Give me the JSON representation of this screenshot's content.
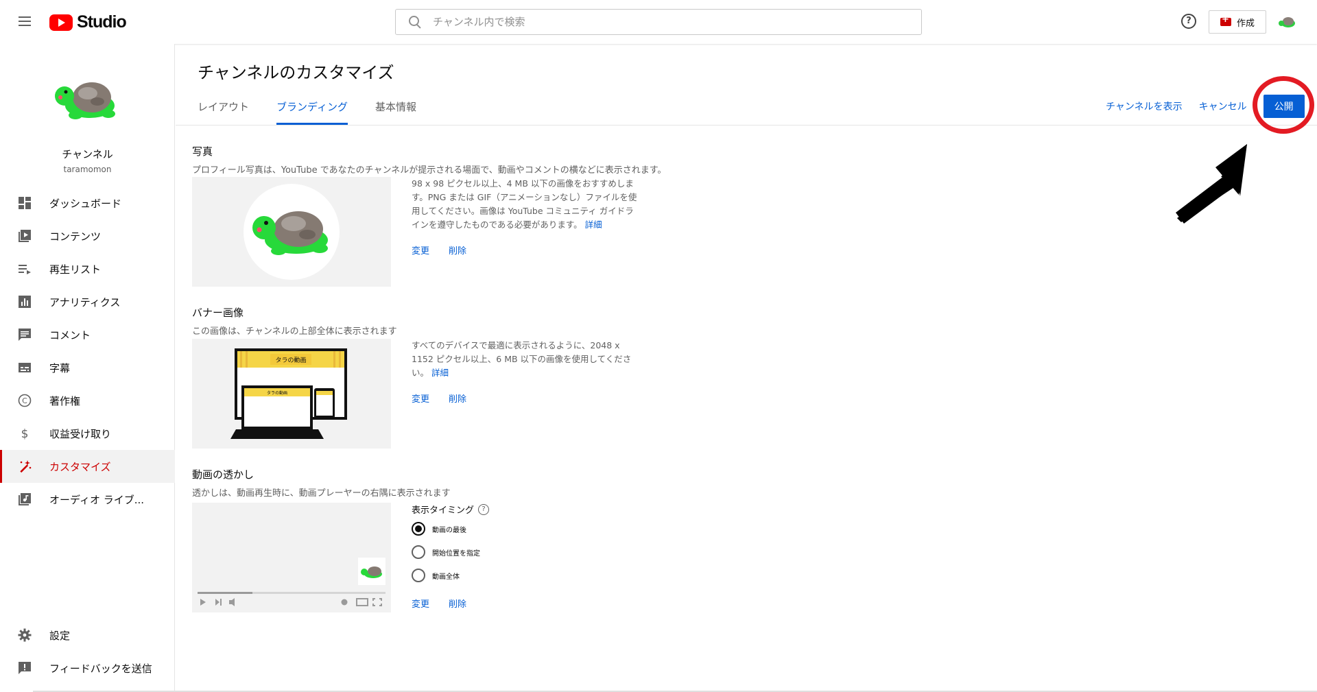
{
  "header": {
    "logo_text": "Studio",
    "search_placeholder": "チャンネル内で検索",
    "help_label": "?",
    "create_label": "作成"
  },
  "sidebar": {
    "channel_name": "チャンネル",
    "channel_handle": "taramomon",
    "items": [
      {
        "label": "ダッシュボード",
        "icon": "dashboard-icon"
      },
      {
        "label": "コンテンツ",
        "icon": "content-icon"
      },
      {
        "label": "再生リスト",
        "icon": "playlist-icon"
      },
      {
        "label": "アナリティクス",
        "icon": "analytics-icon"
      },
      {
        "label": "コメント",
        "icon": "comment-icon"
      },
      {
        "label": "字幕",
        "icon": "subtitles-icon"
      },
      {
        "label": "著作権",
        "icon": "copyright-icon"
      },
      {
        "label": "収益受け取り",
        "icon": "dollar-icon"
      },
      {
        "label": "カスタマイズ",
        "icon": "magic-wand-icon",
        "active": true
      },
      {
        "label": "オーディオ ライブ...",
        "icon": "audio-library-icon"
      }
    ],
    "bottom_items": [
      {
        "label": "設定",
        "icon": "gear-icon"
      },
      {
        "label": "フィードバックを送信",
        "icon": "feedback-icon"
      }
    ]
  },
  "main": {
    "title": "チャンネルのカスタマイズ",
    "tabs": [
      {
        "label": "レイアウト"
      },
      {
        "label": "ブランディング",
        "active": true
      },
      {
        "label": "基本情報"
      }
    ],
    "actions": {
      "view_channel": "チャンネルを表示",
      "cancel": "キャンセル",
      "publish": "公開"
    },
    "photo": {
      "title": "写真",
      "desc": "プロフィール写真は、YouTube であなたのチャンネルが提示される場面で、動画やコメントの横などに表示されます。",
      "info": "98 x 98 ピクセル以上、4 MB 以下の画像をおすすめします。PNG または GIF（アニメーションなし）ファイルを使用してください。画像は YouTube コミュニティ ガイドラインを遵守したものである必要があります。",
      "more": "詳細",
      "change": "変更",
      "remove": "削除"
    },
    "banner": {
      "title": "バナー画像",
      "desc": "この画像は、チャンネルの上部全体に表示されます",
      "info": "すべてのデバイスで最適に表示されるように、2048 x 1152 ピクセル以上、6 MB 以下の画像を使用してください。",
      "more": "詳細",
      "change": "変更",
      "remove": "削除",
      "banner_text": "タラの動画"
    },
    "watermark": {
      "title": "動画の透かし",
      "desc": "透かしは、動画再生時に、動画プレーヤーの右隅に表示されます",
      "timing_title": "表示タイミング",
      "options": [
        {
          "label": "動画の最後",
          "checked": true
        },
        {
          "label": "開始位置を指定",
          "checked": false
        },
        {
          "label": "動画全体",
          "checked": false
        }
      ],
      "change": "変更",
      "remove": "削除"
    }
  },
  "colors": {
    "accent": "#065fd4",
    "brand_red": "#ff0000",
    "active_red": "#cc0000",
    "highlight": "#e31b23"
  }
}
